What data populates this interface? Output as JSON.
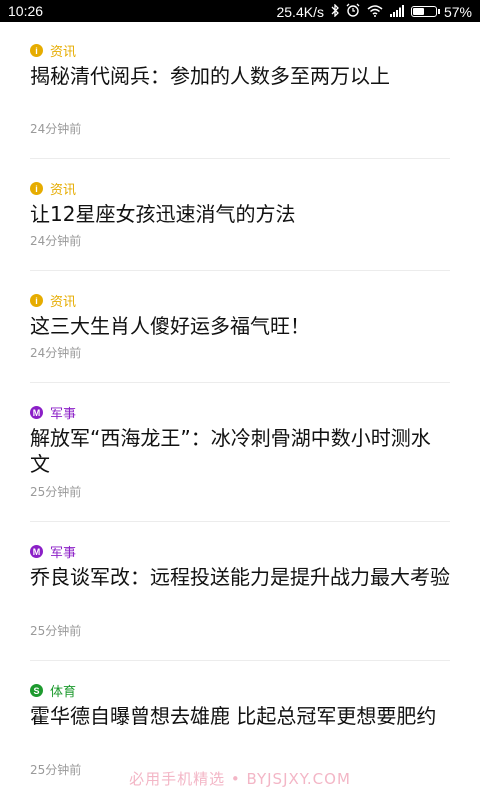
{
  "status_bar": {
    "time": "10:26",
    "speed": "25.4K/s",
    "battery": "57%",
    "battery_level": 0.57,
    "icons": [
      "bluetooth-icon",
      "alarm-icon",
      "wifi-icon",
      "signal-icon",
      "battery-icon"
    ]
  },
  "categories": {
    "news": {
      "label": "资讯",
      "badge": "i",
      "color": "#e6ac00"
    },
    "military": {
      "label": "军事",
      "badge": "M",
      "color": "#8b1fc7"
    },
    "sports": {
      "label": "体育",
      "badge": "S",
      "color": "#1d9a2e"
    }
  },
  "feed": [
    {
      "category": "资讯",
      "badge": "i",
      "title": "揭秘清代阅兵：参加的人数多至两万以上",
      "time": "24分钟前"
    },
    {
      "category": "资讯",
      "badge": "i",
      "title": "让12星座女孩迅速消气的方法",
      "time": "24分钟前"
    },
    {
      "category": "资讯",
      "badge": "i",
      "title": "这三大生肖人傻好运多福气旺！",
      "time": "24分钟前"
    },
    {
      "category": "军事",
      "badge": "M",
      "title": "解放军“西海龙王”：冰冷刺骨湖中数小时测水文",
      "time": "25分钟前"
    },
    {
      "category": "军事",
      "badge": "M",
      "title": "乔良谈军改：远程投送能力是提升战力最大考验",
      "time": "25分钟前"
    },
    {
      "category": "体育",
      "badge": "S",
      "title": "霍华德自曝曾想去雄鹿 比起总冠军更想要肥约",
      "time": "25分钟前"
    }
  ],
  "watermark": "必用手机精选 • BYJSJXY.COM"
}
